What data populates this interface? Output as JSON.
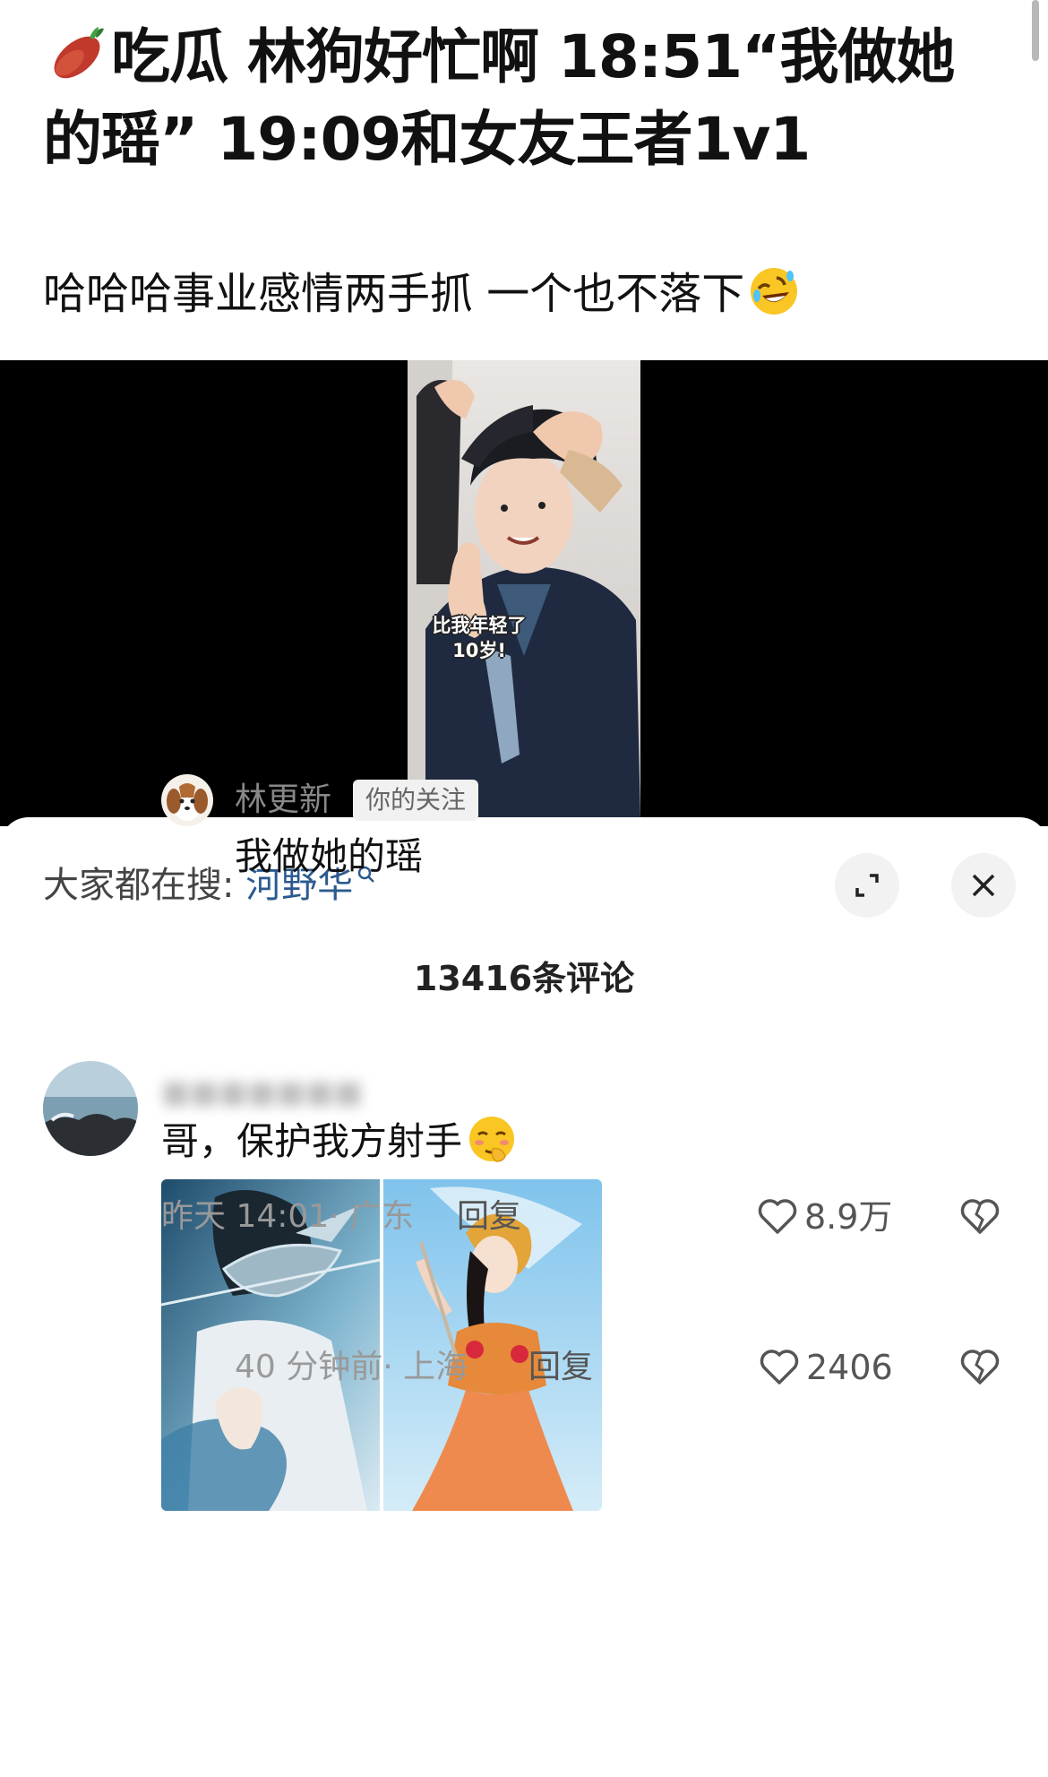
{
  "post": {
    "title_icon": "sweet-potato-icon",
    "title": "吃瓜 林狗好忙啊 18:51“我做她的瑶” 19:09和女友王者1v1",
    "subtitle": "哈哈哈事业感情两手抓 一个也不落下",
    "subtitle_emoji": "rolling-laugh-emoji"
  },
  "video": {
    "caption_line1": "比我年轻了",
    "caption_line2": "10岁!"
  },
  "sheet": {
    "search_prefix": "大家都在搜:",
    "search_keyword": "河野华",
    "expand_icon": "expand-icon",
    "close_icon": "close-icon",
    "comment_count": "13416条评论"
  },
  "comments": [
    {
      "text": "哥，保护我方射手",
      "emoji": "shy-face-emoji",
      "time": "昨天 14:01",
      "location": "· 广东",
      "reply_label": "回复",
      "likes": "8.9万",
      "replies": [
        {
          "username": "林更新",
          "badge": "你的关注",
          "text": "我做她的瑶",
          "time": "40 分钟前",
          "location": "· 上海",
          "reply_label": "回复",
          "likes": "2406"
        }
      ]
    }
  ],
  "colors": {
    "keyword_blue": "#2b5a8f",
    "video_bg": "#000000",
    "muted_text": "#999999"
  }
}
